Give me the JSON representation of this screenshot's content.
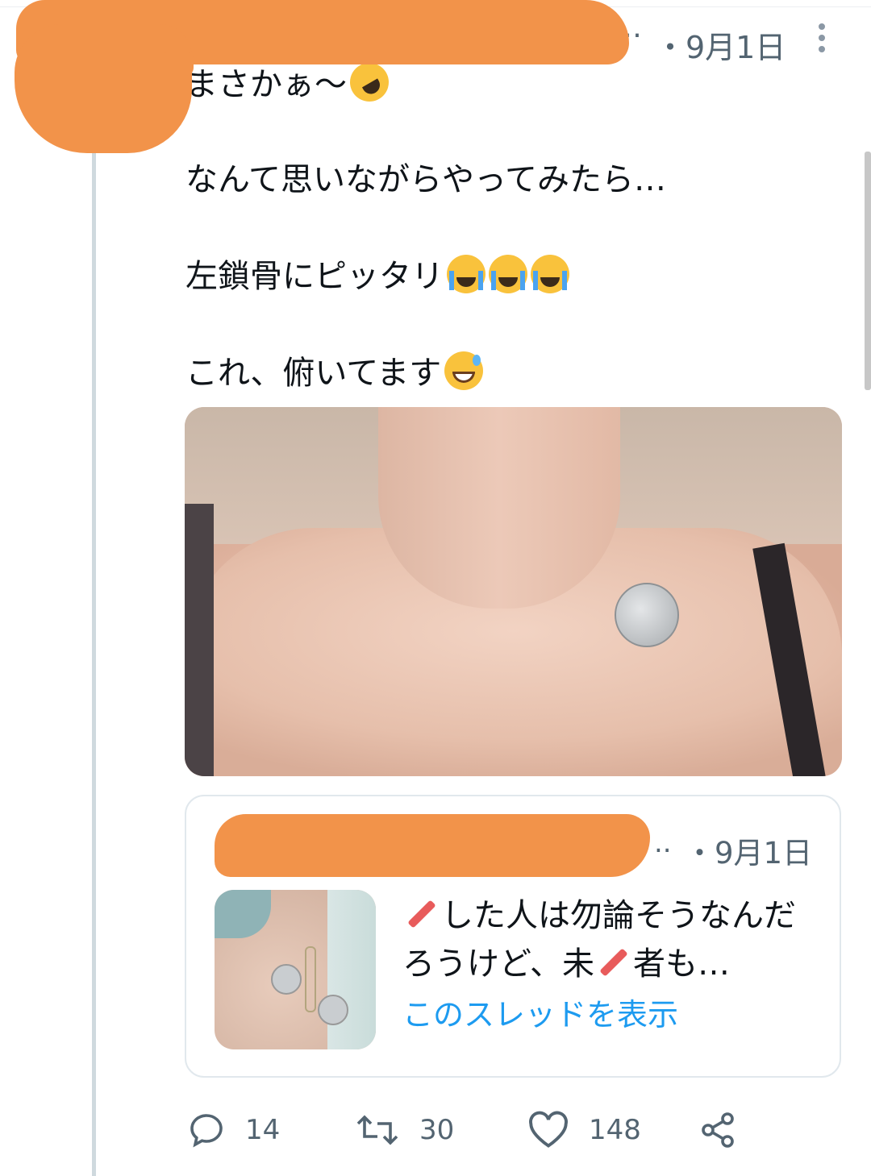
{
  "tweet": {
    "header_ellipsis": "…",
    "date": "・9月1日",
    "lines": [
      "まさかぁ〜",
      "なんて思いながらやってみたら…",
      "左鎖骨にピッタリ",
      "これ、俯いてます"
    ]
  },
  "quoted": {
    "ellipsis": "..",
    "date": "・9月1日",
    "text_part1": "した人は勿論そうなんだろうけど、未",
    "text_part2": "者も…",
    "show_thread": "このスレッドを表示"
  },
  "actions": {
    "reply_count": "14",
    "retweet_count": "30",
    "like_count": "148"
  },
  "colors": {
    "accent": "#1d9bf0",
    "redaction": "#f2934a",
    "muted": "#536471"
  }
}
